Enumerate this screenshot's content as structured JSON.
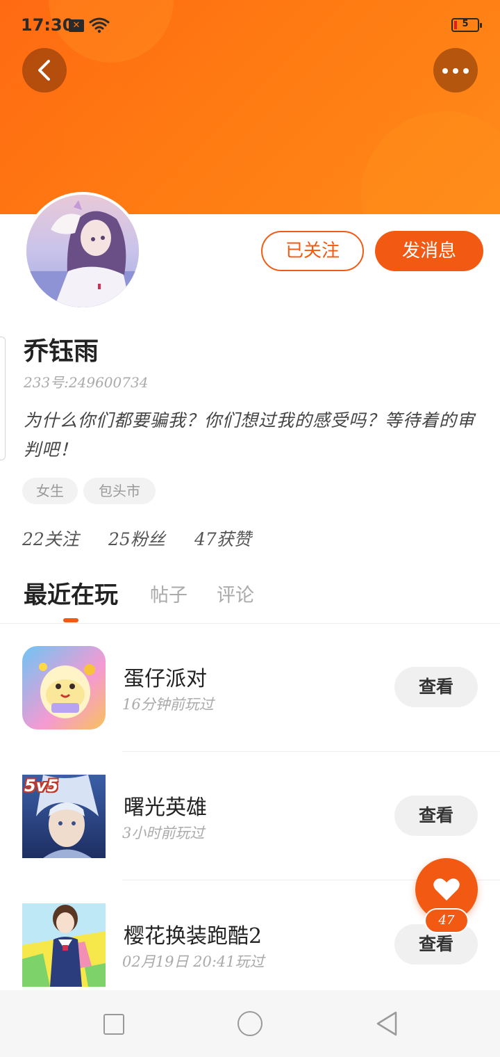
{
  "status_bar": {
    "time": "17:30",
    "notification_badge": "✕",
    "battery_level": "5",
    "icons": [
      "notification-x-icon",
      "wifi-icon",
      "battery-icon"
    ]
  },
  "header": {
    "back_icon": "chevron-left-icon",
    "more_icon": "more-dots-icon",
    "accent_color": "#ff7a12"
  },
  "profile": {
    "name": "乔钰雨",
    "uid": "233号:249600734",
    "bio": "为什么你们都要骗我？你们想过我的感受吗？等待着的审判吧！",
    "tags": [
      "女生",
      "包头市"
    ],
    "stats": {
      "following": "22关注",
      "followers": "25粉丝",
      "likes": "47获赞"
    },
    "actions": {
      "followed_label": "已关注",
      "message_label": "发消息"
    }
  },
  "tabs": {
    "items": [
      "最近在玩",
      "帖子",
      "评论"
    ],
    "active": "最近在玩"
  },
  "games": [
    {
      "title": "蛋仔派对",
      "played": "16分钟前玩过",
      "action": "查看",
      "icon": "eggy-party-icon"
    },
    {
      "title": "曙光英雄",
      "played": "3小时前玩过",
      "action": "查看",
      "icon": "dawn-hero-icon",
      "badge": "5v5"
    },
    {
      "title": "樱花换装跑酷2",
      "played": "02月19日 20:41玩过",
      "action": "查看",
      "icon": "sakura-runner-icon"
    }
  ],
  "like_fab": {
    "icon": "heart-icon",
    "count": "47"
  },
  "nav_bar": {
    "icons": [
      "recent-apps-icon",
      "home-icon",
      "back-icon"
    ]
  },
  "colors": {
    "primary": "#f25a14",
    "header_gradient_start": "#ff6a13",
    "header_gradient_end": "#ff8a1a",
    "muted_text": "#aaaaaa"
  }
}
